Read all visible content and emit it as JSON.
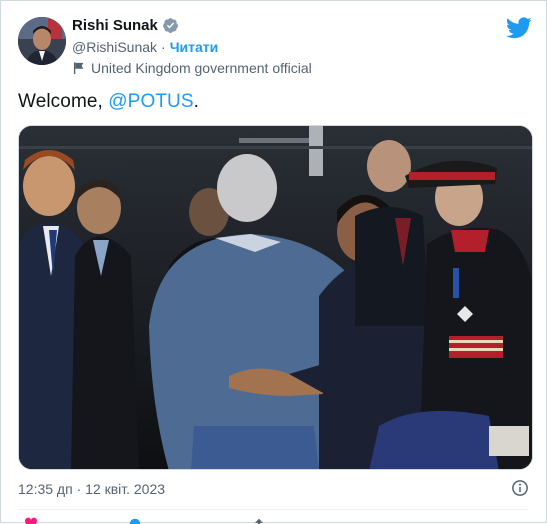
{
  "author": {
    "display_name": "Rishi Sunak",
    "handle": "@RishiSunak",
    "separator": "·",
    "follow_label": "Читати",
    "label": "United Kingdom government official",
    "verified": true
  },
  "tweet": {
    "text_prefix": "Welcome, ",
    "mention": "@POTUS",
    "text_suffix": "."
  },
  "footer": {
    "timestamp": "12:35 дп · 12 квіт. 2023"
  },
  "icons": {
    "brand": "twitter-bird-icon",
    "verified": "verified-badge-icon",
    "label": "flag-icon",
    "info": "info-icon"
  },
  "colors": {
    "accent": "#1d9bf0",
    "secondary_text": "#536471",
    "primary_text": "#0f1419"
  }
}
